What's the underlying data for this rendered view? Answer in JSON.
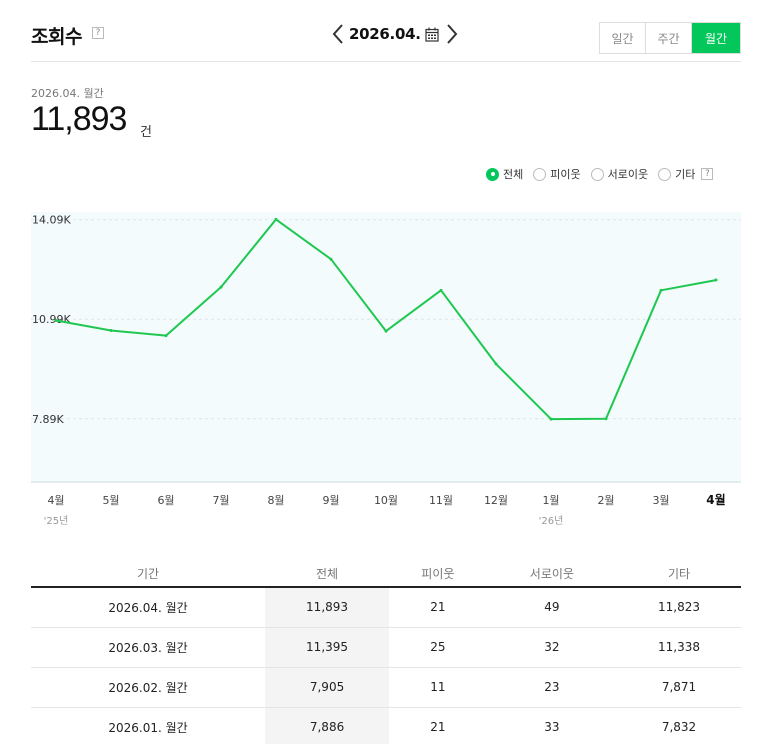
{
  "header": {
    "title": "조회수",
    "help_symbol": "?",
    "date_label": "2026.04.",
    "tabs": [
      {
        "label": "일간",
        "active": false
      },
      {
        "label": "주간",
        "active": false
      },
      {
        "label": "월간",
        "active": true
      }
    ]
  },
  "summary": {
    "period_label": "2026.04. 월간",
    "value": "11,893",
    "unit": "건"
  },
  "filters": [
    {
      "label": "전체",
      "checked": true
    },
    {
      "label": "피이웃",
      "checked": false
    },
    {
      "label": "서로이웃",
      "checked": false
    },
    {
      "label": "기타",
      "checked": false
    }
  ],
  "colors": {
    "accent": "#03c75a",
    "line": "#1ec850",
    "plot_background": "#f3fbfd"
  },
  "chart_data": {
    "type": "line",
    "categories": [
      "4월",
      "5월",
      "6월",
      "7월",
      "8월",
      "9월",
      "10월",
      "11월",
      "12월",
      "1월",
      "2월",
      "3월",
      "4월"
    ],
    "year_labels": [
      {
        "index": 0,
        "label": "'25년"
      },
      {
        "index": 9,
        "label": "'26년"
      }
    ],
    "highlight_index": 12,
    "series": [
      {
        "values": [
          10950,
          10640,
          10480,
          11990,
          14100,
          12860,
          10620,
          11890,
          9600,
          7880,
          7890,
          11890,
          12210
        ]
      }
    ],
    "y_ticks": [
      {
        "value": 14090,
        "label": "14.09K"
      },
      {
        "value": 10990,
        "label": "10.99K"
      },
      {
        "value": 7890,
        "label": "7.89K"
      }
    ],
    "ylim": [
      5920,
      14330
    ],
    "grid": true
  },
  "table": {
    "headers": [
      "기간",
      "전체",
      "피이웃",
      "서로이웃",
      "기타"
    ],
    "rows": [
      [
        "2026.04. 월간",
        "11,893",
        "21",
        "49",
        "11,823"
      ],
      [
        "2026.03. 월간",
        "11,395",
        "25",
        "32",
        "11,338"
      ],
      [
        "2026.02. 월간",
        "7,905",
        "11",
        "23",
        "7,871"
      ],
      [
        "2026.01. 월간",
        "7,886",
        "21",
        "33",
        "7,832"
      ]
    ]
  }
}
